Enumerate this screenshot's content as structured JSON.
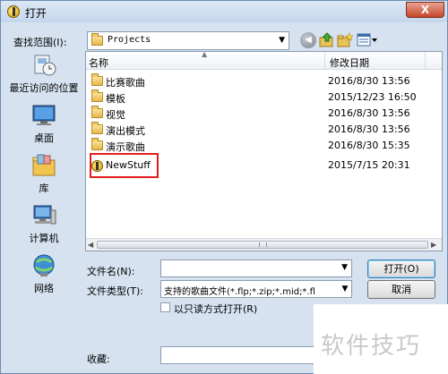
{
  "window": {
    "title": "打开",
    "close_glyph": "X"
  },
  "lookin": {
    "label": "查找范围(I):",
    "value": "Projects"
  },
  "toolbar": {
    "back_icon": "back-arrow-icon",
    "up_icon": "up-folder-icon",
    "new_folder_icon": "new-folder-icon",
    "view_menu_icon": "view-menu-icon"
  },
  "places": [
    {
      "label": "最近访问的位置",
      "icon": "recent-places-icon"
    },
    {
      "label": "桌面",
      "icon": "desktop-icon"
    },
    {
      "label": "库",
      "icon": "libraries-icon"
    },
    {
      "label": "计算机",
      "icon": "computer-icon"
    },
    {
      "label": "网络",
      "icon": "network-icon"
    }
  ],
  "list": {
    "columns": {
      "name": "名称",
      "date": "修改日期"
    },
    "rows": [
      {
        "name": "比赛歌曲",
        "date": "2016/8/30 13:56",
        "type": "folder"
      },
      {
        "name": "模板",
        "date": "2015/12/23 16:50",
        "type": "folder"
      },
      {
        "name": "视觉",
        "date": "2016/8/30 13:56",
        "type": "folder"
      },
      {
        "name": "演出模式",
        "date": "2016/8/30 13:56",
        "type": "folder"
      },
      {
        "name": "演示歌曲",
        "date": "2016/8/30 15:35",
        "type": "folder"
      },
      {
        "name": "NewStuff",
        "date": "2015/7/15 20:31",
        "type": "song"
      }
    ],
    "highlight_color": "#e11f1f"
  },
  "form": {
    "filename_label": "文件名(N):",
    "filename_value": "",
    "filetype_label": "文件类型(T):",
    "filetype_value": "支持的歌曲文件(*.flp;*.zip;*.mid;*.fl",
    "readonly_label": "以只读方式打开(R)",
    "open_label": "打开(O)",
    "cancel_label": "取消",
    "favorites_label": "收藏:"
  },
  "watermark": {
    "text": "软件技巧"
  }
}
